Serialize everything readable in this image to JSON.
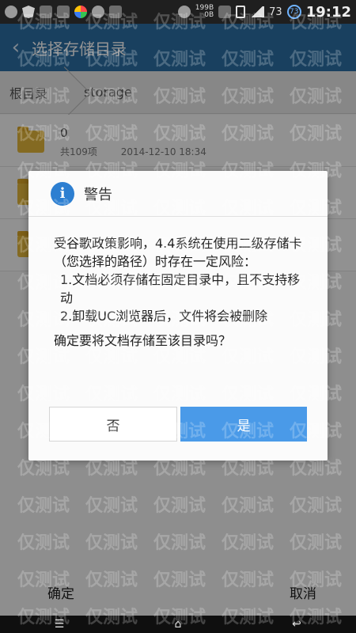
{
  "status_bar": {
    "speed_top": "199B",
    "speed_bottom": "0B",
    "battery_num": "73",
    "badge": "73",
    "time": "19:12"
  },
  "header": {
    "back_icon": "‹",
    "title": "选择存储目录"
  },
  "breadcrumb": {
    "root": "根目录",
    "current": "storage"
  },
  "files": [
    {
      "name": "0",
      "count": "共109项",
      "date": "2014-12-10 18:34"
    }
  ],
  "dialog": {
    "title": "警告",
    "info_icon": "i",
    "line1": "受谷歌政策影响，4.4系统在使用二级存储卡（您选择的路径）时存在一定风险：",
    "line2": "1.文档必须存储在固定目录中，且不支持移动",
    "line3": "2.卸载UC浏览器后，文件将会被删除",
    "line4": "确定要将文档存储至该目录吗？",
    "no_label": "否",
    "yes_label": "是"
  },
  "bottom": {
    "confirm": "确定",
    "cancel": "取消"
  },
  "navbar": {
    "menu_icon": "☰",
    "home_icon": "⌂",
    "back_icon": "↩"
  },
  "watermark": "仅测试",
  "colors": {
    "header": "#2c6ea4",
    "accent": "#4a9ae8",
    "folder": "#e4b73b"
  }
}
